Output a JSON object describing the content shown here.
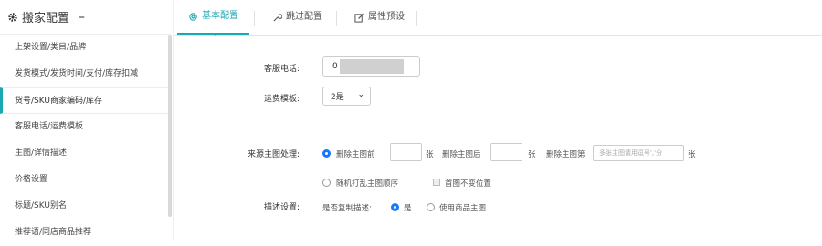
{
  "sidebar": {
    "title": "搬家配置",
    "collapse": "–",
    "items": [
      {
        "label": "上架设置/类目/品牌"
      },
      {
        "label": "发货模式/发货时间/支付/库存扣减"
      },
      {
        "label": "货号/SKU商家编码/库存"
      },
      {
        "label": "客服电话/运费模板"
      },
      {
        "label": "主图/详情描述"
      },
      {
        "label": "价格设置"
      },
      {
        "label": "标题/SKU别名"
      },
      {
        "label": "推荐语/同店商品推荐"
      }
    ],
    "active_index": 2
  },
  "tabs": [
    {
      "label": "基本配置",
      "icon": "gear-icon",
      "active": true
    },
    {
      "label": "跳过配置",
      "icon": "wrench-icon",
      "active": false
    },
    {
      "label": "属性预设",
      "icon": "edit-icon",
      "active": false
    }
  ],
  "form": {
    "phone": {
      "label": "客服电话:",
      "value": "0"
    },
    "shipping": {
      "label": "运费模板:",
      "value": "2是"
    },
    "main_image": {
      "label": "来源主图处理:",
      "delete_front": "删除主图前",
      "unit1": "张",
      "delete_back": "删除主图后",
      "unit2": "张",
      "delete_nth": "删除主图第",
      "nth_placeholder": "多张主图请用逗号','分",
      "unit3": "张",
      "shuffle": "随机打乱主图顺序",
      "keep_first": "首图不变位置"
    },
    "desc": {
      "label": "描述设置:",
      "copy_label": "是否复制描述:",
      "yes": "是",
      "use_main": "使用商品主图"
    }
  },
  "colors": {
    "accent": "#1aa9b3",
    "radio": "#1677ff"
  }
}
